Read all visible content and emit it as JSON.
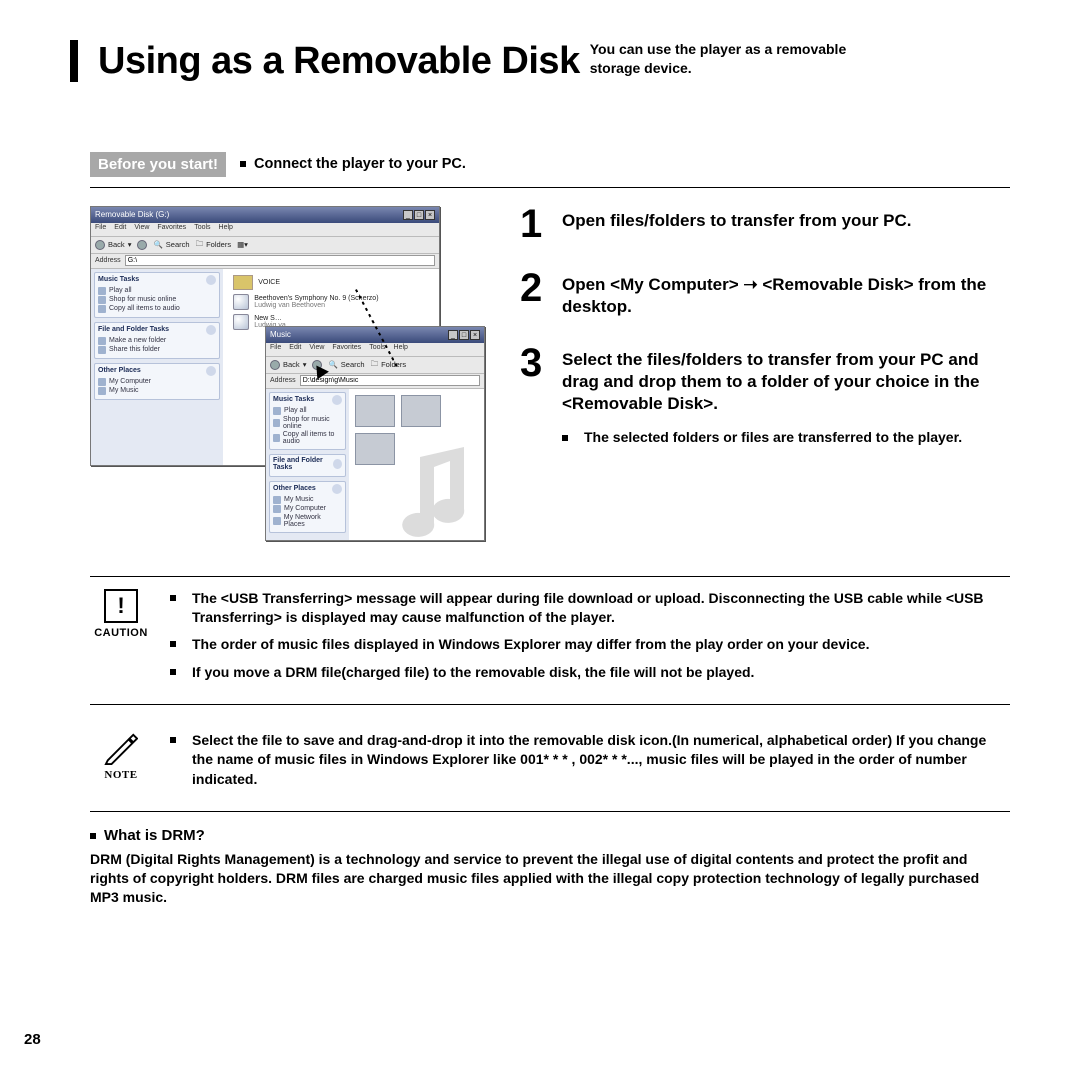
{
  "page_number": "28",
  "title": "Using as a Removable Disk",
  "intro": "You can use the player as a removable storage device.",
  "before": {
    "badge": "Before you start!",
    "text": "Connect the player to your PC."
  },
  "steps": [
    {
      "n": "1",
      "text": "Open files/folders to transfer from your PC."
    },
    {
      "n": "2",
      "text": "Open <My Computer> ➝ <Removable Disk> from the desktop."
    },
    {
      "n": "3",
      "text": "Select the files/folders to transfer from your PC and drag and drop them to a folder of your choice in the <Removable Disk>.",
      "sub": "The selected folders or files are transferred to the player."
    }
  ],
  "caution": {
    "label": "CAUTION",
    "items": [
      "The <USB Transferring> message will appear during file download or upload. Disconnecting the USB cable while <USB Transferring> is displayed may cause malfunction of the player.",
      "The order of music files displayed in Windows Explorer may differ from the play order on your device.",
      "If you move a DRM file(charged file)  to the removable disk, the file will not be played."
    ]
  },
  "note": {
    "label": "NOTE",
    "items": [
      "Select the file to save and drag-and-drop it into the removable disk icon.(In numerical, alphabetical order) If you change the name of music files in Windows Explorer like 001* * * , 002* * *..., music files will be played in the order of number indicated."
    ]
  },
  "drm": {
    "heading": "What is DRM?",
    "body": "DRM (Digital Rights Management) is a technology and service to prevent the illegal use of digital contents and protect the profit and rights of copyright holders. DRM files are charged music files applied with the illegal copy protection technology of legally purchased MP3 music."
  },
  "screenshot": {
    "win1": {
      "title": "Removable Disk (G:)",
      "menu": [
        "File",
        "Edit",
        "View",
        "Favorites",
        "Tools",
        "Help"
      ],
      "toolbar": [
        "Back",
        "Search",
        "Folders"
      ],
      "addr_label": "Address",
      "addr_value": "G:\\",
      "panels": {
        "music_tasks": {
          "title": "Music Tasks",
          "items": [
            "Play all",
            "Shop for music online",
            "Copy all items to audio"
          ]
        },
        "file_tasks": {
          "title": "File and Folder Tasks",
          "items": [
            "Make a new folder",
            "Share this folder"
          ]
        },
        "other": {
          "title": "Other Places",
          "items": [
            "My Computer",
            "My Music"
          ]
        }
      },
      "files": [
        {
          "type": "folder",
          "name": "VOICE"
        },
        {
          "type": "file",
          "name": "Beethoven's Symphony No. 9 (Scherzo)",
          "sub": "Ludwig van Beethoven"
        },
        {
          "type": "file",
          "name": "New S…",
          "sub": "Ludwig va…"
        }
      ]
    },
    "win2": {
      "title": "Music",
      "menu": [
        "File",
        "Edit",
        "View",
        "Favorites",
        "Tools",
        "Help"
      ],
      "toolbar": [
        "Back",
        "Search",
        "Folders"
      ],
      "addr_label": "Address",
      "addr_value": "D:\\design\\g\\Music",
      "panels": {
        "music_tasks": {
          "title": "Music Tasks",
          "items": [
            "Play all",
            "Shop for music online",
            "Copy all items to audio"
          ]
        },
        "file_tasks": {
          "title": "File and Folder Tasks"
        },
        "other": {
          "title": "Other Places",
          "items": [
            "My Music",
            "My Computer",
            "My Network Places"
          ]
        }
      }
    }
  }
}
